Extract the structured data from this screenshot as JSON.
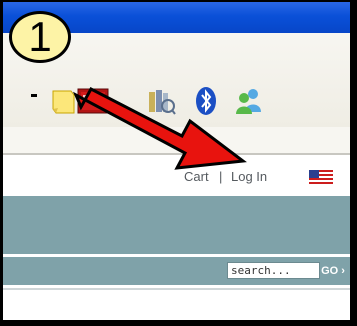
{
  "annotation": {
    "step_number": "1",
    "arrow_color": "#e8130e"
  },
  "browser": {
    "titlebar_color": "#0a50d8",
    "toolbar_icons": [
      "dropdown-arrow-icon",
      "note-icon",
      "red-book-icon",
      "library-icon",
      "bluetooth-icon",
      "messenger-icon"
    ]
  },
  "site": {
    "utility_nav": {
      "cart_label": "Cart",
      "separator": "|",
      "login_label": "Log In",
      "flag": "us-flag-icon"
    },
    "search": {
      "placeholder": "search...",
      "value": "",
      "go_label": "GO ›"
    },
    "colors": {
      "band": "#7fa2a9",
      "nav_text": "#555a5f"
    }
  }
}
